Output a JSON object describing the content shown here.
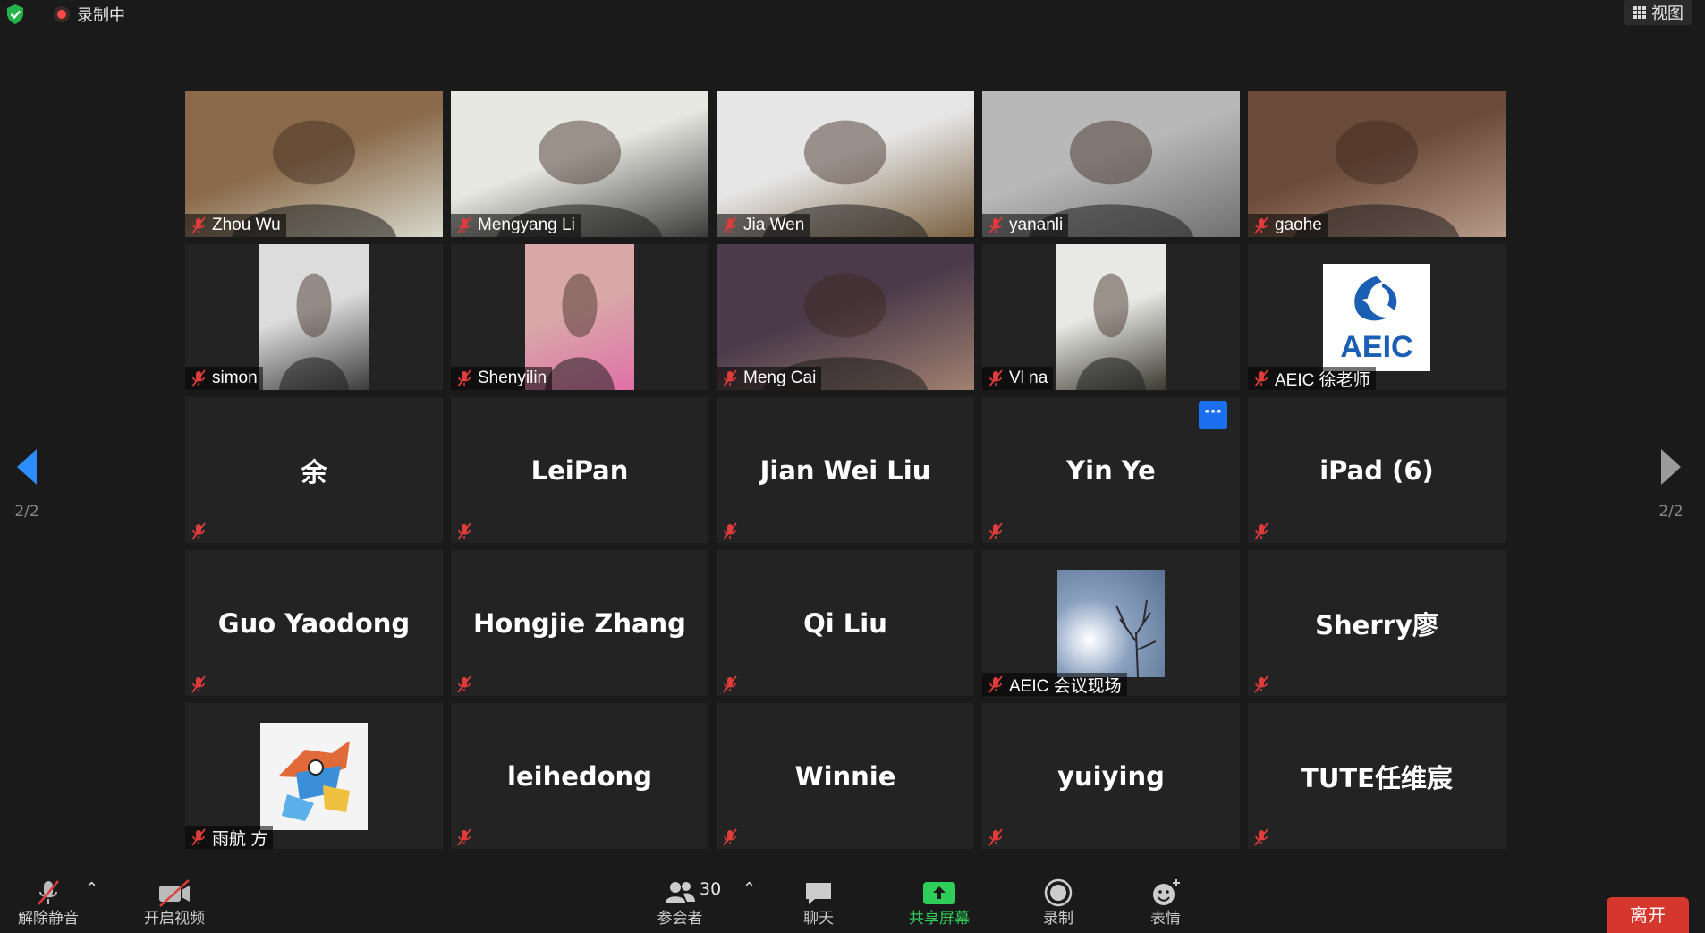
{
  "topbar": {
    "recording_label": "录制中",
    "view_label": "视图"
  },
  "nav": {
    "page_indicator": "2/2"
  },
  "participants": [
    {
      "name": "Zhou Wu",
      "type": "video",
      "bg": [
        "#8a6a4a",
        "#d8d8cc"
      ]
    },
    {
      "name": "Mengyang Li",
      "type": "video",
      "bg": [
        "#e8e8e2",
        "#3a3a3a"
      ]
    },
    {
      "name": "Jia Wen",
      "type": "video",
      "bg": [
        "#e6e6e6",
        "#7a6040"
      ]
    },
    {
      "name": "yananli",
      "type": "video",
      "bg": [
        "#b8b8b8",
        "#707070"
      ]
    },
    {
      "name": "gaohe",
      "type": "video",
      "bg": [
        "#6a4a38",
        "#b89a88"
      ]
    },
    {
      "name": "simon",
      "type": "video-narrow",
      "bg": [
        "#dcdcdc",
        "#3c3c3c"
      ]
    },
    {
      "name": "Shenyilin",
      "type": "video-narrow",
      "bg": [
        "#d8a8a8",
        "#e070a8"
      ]
    },
    {
      "name": "Meng Cai",
      "type": "video",
      "bg": [
        "#4a3a4a",
        "#a08070"
      ]
    },
    {
      "name": "Vl na",
      "type": "video-narrow",
      "bg": [
        "#e8e8e4",
        "#3a3a30"
      ]
    },
    {
      "name": "AEIC 徐老师",
      "type": "avatar-aeic",
      "logo_text": "AEIC"
    },
    {
      "name": "余",
      "type": "name"
    },
    {
      "name": "LeiPan",
      "type": "name"
    },
    {
      "name": "Jian Wei Liu",
      "type": "name"
    },
    {
      "name": "Yin Ye",
      "type": "name",
      "has_more": true,
      "more_label": "···"
    },
    {
      "name": "iPad (6)",
      "type": "name"
    },
    {
      "name": "Guo Yaodong",
      "type": "name"
    },
    {
      "name": "Hongjie Zhang",
      "type": "name"
    },
    {
      "name": "Qi Liu",
      "type": "name"
    },
    {
      "name": "AEIC 会议现场",
      "type": "avatar-sky"
    },
    {
      "name": "Sherry廖",
      "type": "name"
    },
    {
      "name": "雨航 方",
      "type": "avatar-cartoon"
    },
    {
      "name": "leihedong",
      "type": "name"
    },
    {
      "name": "Winnie",
      "type": "name"
    },
    {
      "name": "yuiying",
      "type": "name"
    },
    {
      "name": "TUTE任维宸",
      "type": "name"
    }
  ],
  "toolbar": {
    "unmute_label": "解除静音",
    "start_video_label": "开启视频",
    "participants_count": "30",
    "participants_label": "参会者",
    "chat_label": "聊天",
    "share_label": "共享屏幕",
    "record_label": "录制",
    "reactions_label": "表情",
    "leave_label": "离开"
  },
  "colors": {
    "background": "#1a1a1a",
    "tile": "#232323",
    "accent_blue": "#1d6ff2",
    "nav_arrow": "#2d8cff",
    "share_green": "#2fce5a",
    "mute_red": "#e03c3c",
    "leave_red": "#d5372d"
  }
}
